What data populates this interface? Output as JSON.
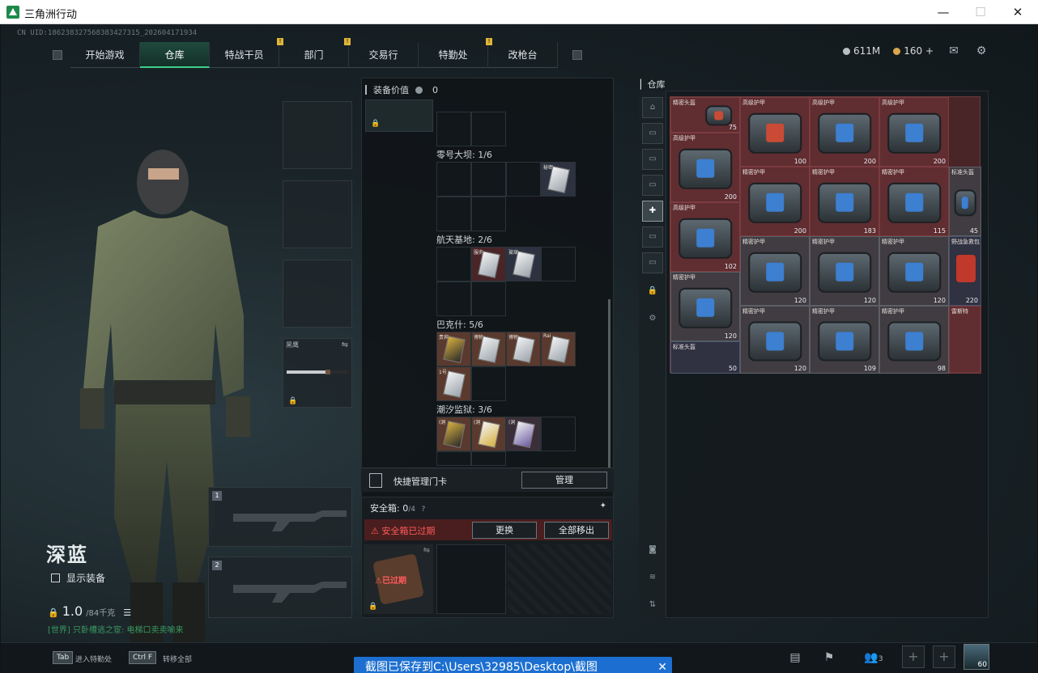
{
  "window": {
    "title": "三角洲行动",
    "minimize": "—",
    "maximize": "☐",
    "close": "✕"
  },
  "header": {
    "uid": "CN UID:186238327568383427315_202604171934",
    "tabs": [
      {
        "label": "开始游戏",
        "badge": ""
      },
      {
        "label": "仓库",
        "badge": ""
      },
      {
        "label": "特战干员",
        "badge": "!"
      },
      {
        "label": "部门",
        "badge": ""
      },
      {
        "label": "交易行",
        "badge": "!"
      },
      {
        "label": "特勤处",
        "badge": ""
      },
      {
        "label": "改枪台",
        "badge": "!"
      }
    ],
    "currency_hafcoin": "611M",
    "currency_coupon": "160",
    "coupon_plus": "+"
  },
  "character": {
    "name": "深蓝",
    "show_equipment": "显示装备",
    "weight": "1.0",
    "weight_unit": "/84千克",
    "chat": "[世界] 只卧槽逃之宦: 电梯口卖卖喻来"
  },
  "equip": {
    "melee_label": "黑鹰",
    "slot1_num": "1",
    "slot2_num": "2"
  },
  "middle": {
    "value_label": "装备价值",
    "value": "0",
    "sections": [
      {
        "label": "零号大坝: 1/6"
      },
      {
        "label": "航天基地: 2/6"
      },
      {
        "label": "巴克什: 5/6"
      },
      {
        "label": "潮汐监狱: 3/6"
      }
    ],
    "cards": {
      "dam": [
        "秘密"
      ],
      "space": [
        "服务",
        "玻璃"
      ],
      "bakshi": [
        "贵宾",
        "博物",
        "博物",
        "Rai",
        "1号"
      ],
      "tide": [
        "(洞",
        "(洞",
        "(洞"
      ]
    },
    "quick_keycard": "快捷管理门卡",
    "manage": "管理",
    "safebox_label": "安全箱:",
    "safebox_count": "0",
    "safebox_cap": "/4",
    "safebox_expired": "安全箱已过期",
    "replace": "更换",
    "move_all": "全部移出",
    "expired_tag": "已过期"
  },
  "storage": {
    "title": "仓库",
    "items": [
      {
        "name": "精密头盔",
        "dur": "75",
        "color": "red"
      },
      {
        "name": "高级护甲",
        "dur": "",
        "color": "red"
      },
      {
        "name": "高级护甲",
        "dur": "",
        "color": "red"
      },
      {
        "name": "高级护甲",
        "dur": "",
        "color": "red"
      },
      {
        "name": "高级护甲",
        "dur": "200",
        "color": "red"
      },
      {
        "name": "雷斯特",
        "dur": "",
        "color": "red"
      },
      {
        "name": "高级护甲",
        "dur": "100",
        "color": "red"
      },
      {
        "name": "高级护甲",
        "dur": "200",
        "color": "red"
      },
      {
        "name": "高级护甲",
        "dur": "200",
        "color": "red"
      },
      {
        "name": "高级护甲",
        "dur": "200",
        "color": "red"
      },
      {
        "name": "精密护甲",
        "dur": "183",
        "color": "red"
      },
      {
        "name": "精密护甲",
        "dur": "115",
        "color": "red"
      },
      {
        "name": "标准头盔",
        "dur": "45",
        "color": "gray"
      },
      {
        "name": "高级护甲",
        "dur": "102",
        "color": "red"
      },
      {
        "name": "精密护甲",
        "dur": "120",
        "color": "red"
      },
      {
        "name": "精密护甲",
        "dur": "120",
        "color": "red"
      },
      {
        "name": "精密护甲",
        "dur": "120",
        "color": "red"
      },
      {
        "name": "野战急救包",
        "dur": "220",
        "color": "blue"
      },
      {
        "name": "精密护甲",
        "dur": "120",
        "color": "red"
      },
      {
        "name": "雷斯特",
        "dur": "",
        "color": "red"
      },
      {
        "name": "精密护甲",
        "dur": "120",
        "color": "red"
      },
      {
        "name": "精密护甲",
        "dur": "109",
        "color": "red"
      },
      {
        "name": "精密护甲",
        "dur": "98",
        "color": "red"
      },
      {
        "name": "标准头盔",
        "dur": "50",
        "color": "blue"
      },
      {
        "name": "雷斯特",
        "dur": "",
        "color": "red"
      }
    ]
  },
  "bottom": {
    "tab_key": "Tab",
    "tab_label": "进入特勤处",
    "ctrlf_key": "Ctrl F",
    "ctrlf_label": "转移全部",
    "toast": "截图已保存到C:\\Users\\32985\\Desktop\\截图",
    "friends": "3",
    "level": "60"
  },
  "colors": {
    "accent_green": "#3fd08a",
    "warn_red": "#ff5a5a",
    "badge_yellow": "#e0b53a",
    "toast_blue": "#1c6fd0"
  }
}
